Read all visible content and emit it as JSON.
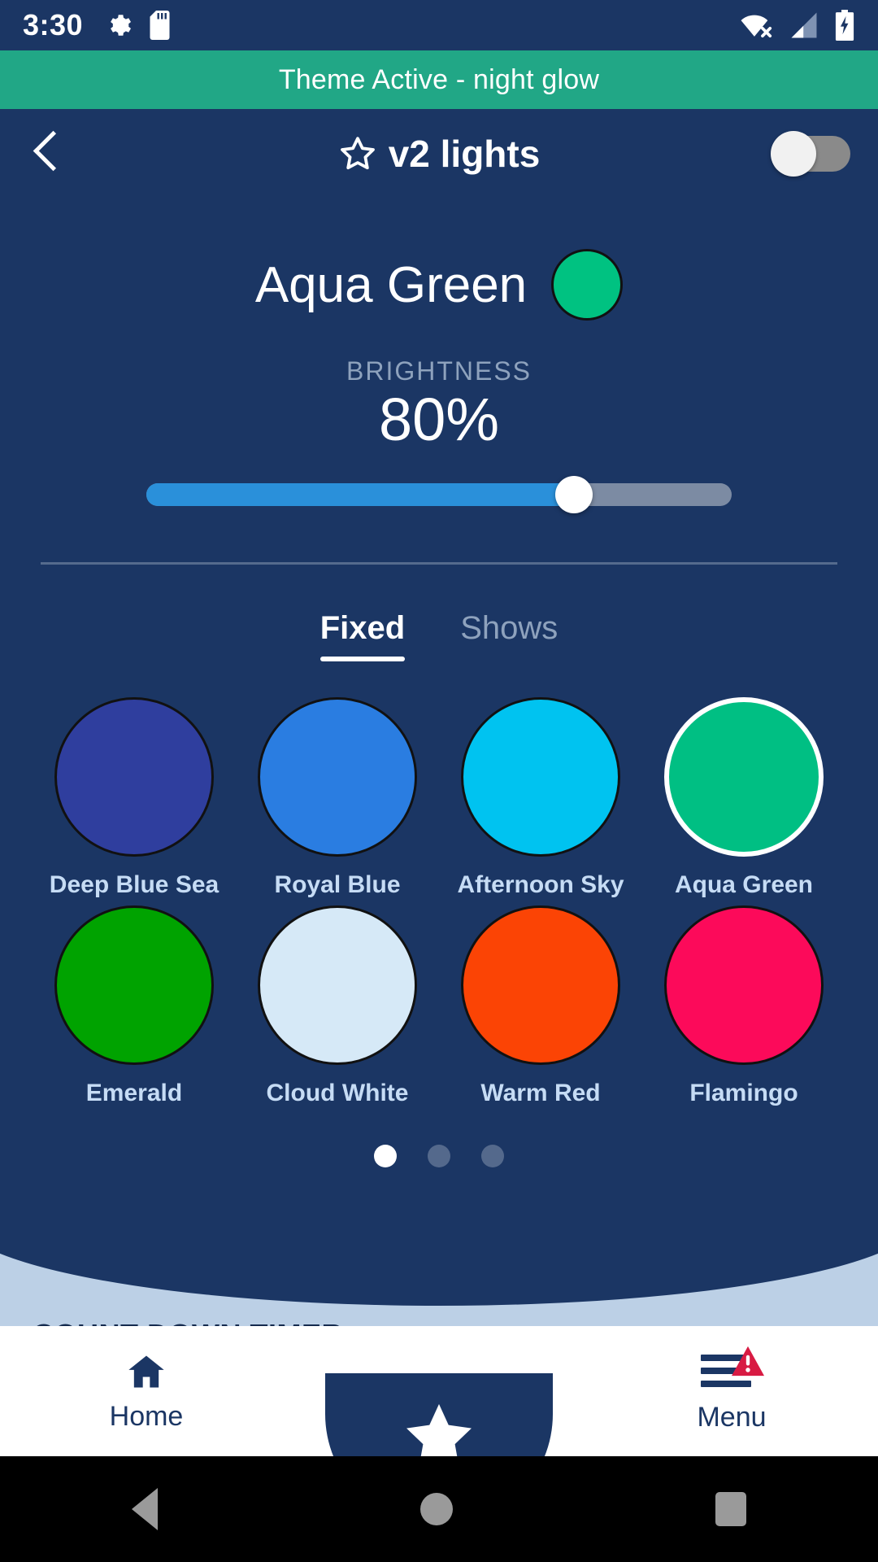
{
  "statusbar": {
    "time": "3:30",
    "icons": [
      "gear-icon",
      "sd-card-icon"
    ],
    "right_icons": [
      "wifi-off-icon",
      "signal-icon",
      "battery-charging-icon"
    ]
  },
  "theme_banner": {
    "text": "Theme Active - night glow",
    "color": "#21a786"
  },
  "header": {
    "back_label": "Back",
    "title": "v2 lights",
    "star_icon": "star-outline-icon",
    "power_toggle_state": "off"
  },
  "current": {
    "color_name": "Aqua Green",
    "color_hex": "#00c281"
  },
  "brightness": {
    "label": "BRIGHTNESS",
    "value_text": "80%",
    "value": 80,
    "fill_percent": 73,
    "fill_color": "#2a90da",
    "track_color": "#7c8ba3"
  },
  "tabs": [
    {
      "label": "Fixed",
      "active": true
    },
    {
      "label": "Shows",
      "active": false
    }
  ],
  "swatches": [
    {
      "label": "Deep Blue Sea",
      "hex": "#2f3e9e",
      "selected": false
    },
    {
      "label": "Royal Blue",
      "hex": "#2a7de1",
      "selected": false
    },
    {
      "label": "Afternoon Sky",
      "hex": "#00c3f0",
      "selected": false
    },
    {
      "label": "Aqua Green",
      "hex": "#00bf83",
      "selected": true
    },
    {
      "label": "Emerald",
      "hex": "#00a300",
      "selected": false
    },
    {
      "label": "Cloud White",
      "hex": "#d6e9f7",
      "selected": false
    },
    {
      "label": "Warm Red",
      "hex": "#fb4405",
      "selected": false
    },
    {
      "label": "Flamingo",
      "hex": "#fc0a5a",
      "selected": false
    }
  ],
  "pager": {
    "count": 3,
    "active_index": 0
  },
  "bottom_panel": {
    "title": "COUNT DOWN TIMER"
  },
  "bottom_nav": {
    "home_label": "Home",
    "home_icon": "home-icon",
    "center_icon": "star-filled-icon",
    "menu_label": "Menu",
    "menu_icon": "hamburger-menu-icon",
    "menu_badge_icon": "warning-triangle-icon"
  },
  "android_nav": {
    "back": "back-triangle-icon",
    "home": "home-circle-icon",
    "recents": "recents-square-icon"
  }
}
